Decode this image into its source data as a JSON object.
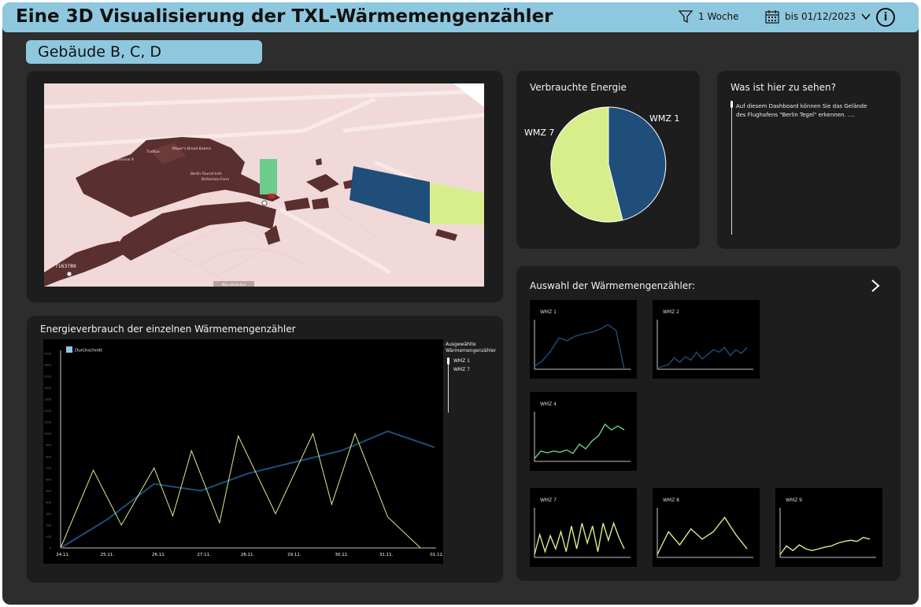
{
  "header": {
    "title": "Eine 3D Visualisierung der TXL-Wärmemengenzähler",
    "filter_label": "1 Woche",
    "date_label": "bis 01/12/2023",
    "filter_icon": "funnel-icon",
    "calendar_icon": "calendar-icon",
    "chevron_icon": "chevron-down-icon",
    "info_icon": "info-icon",
    "info_symbol": "i"
  },
  "building": {
    "label": "Gebäude B, C, D"
  },
  "map": {
    "labels": [
      "Mayer's Bread Bakers",
      "Trafikar",
      "Terminal A",
      "Berlin Tourist Info",
      "Britisches-Farm",
      "red bermo",
      "Layoutfier"
    ],
    "marker_text": "7163789",
    "bottom_tag": "Map attribution",
    "colors": {
      "ground": "#f1d9d9",
      "buildings": "#5a2f2f",
      "green_bar": "#6dcc8b",
      "blue_bar": "#1f4e7a",
      "yellow_bar": "#d8ee8c"
    }
  },
  "energy_pie": {
    "title": "Verbrauchte Energie",
    "label_wmz1": "WMZ 1",
    "label_wmz7": "WMZ 7"
  },
  "info_panel": {
    "title": "Was ist hier zu sehen?",
    "text": "Auf diesem Dashboard können Sie das Gelände des Flughafens \"Berlin Tegel\" erkennen. ...."
  },
  "consumption_chart": {
    "title": "Energieverbrauch der einzelnen Wärmemengenzähler",
    "legend_avg": "Durchschnitt",
    "selector_title": "Ausgewählte Wärmemengenzähler",
    "selector_items": [
      "WMZ 1",
      "WMZ 7"
    ]
  },
  "selection": {
    "title": "Auswahl der Wärmemengenzähler:",
    "next_icon": "chevron-right-icon",
    "tiles": [
      {
        "label": "WMZ 1"
      },
      {
        "label": "WMZ 2"
      },
      {
        "label": "WMZ 4"
      },
      {
        "label": "WMZ 7"
      },
      {
        "label": "WMZ 8"
      },
      {
        "label": "WMZ 9"
      }
    ]
  },
  "chart_data": [
    {
      "type": "pie",
      "title": "Verbrauchte Energie",
      "slices": [
        {
          "label": "WMZ 1",
          "value": 45,
          "color": "#1f4e7a"
        },
        {
          "label": "WMZ 7",
          "value": 55,
          "color": "#d8ee8c"
        }
      ]
    },
    {
      "type": "line",
      "title": "Energieverbrauch der einzelnen Wärmemengenzähler",
      "categories": [
        "24.11.",
        "25.11.",
        "26.11.",
        "27.11.",
        "28.11.",
        "29.11.",
        "30.11.",
        "31.11.",
        "01.12."
      ],
      "ytick_labels": [
        "0",
        "100",
        "200",
        "300",
        "400",
        "500",
        "600",
        "700",
        "800",
        "900",
        "1000",
        "1100",
        "1200",
        "1300",
        "1400",
        "1500",
        "1600",
        "1700"
      ],
      "ylim": [
        0,
        1700
      ],
      "series": [
        {
          "name": "WMZ 1",
          "color": "#1f4e7a",
          "x": [
            0,
            1,
            2,
            3,
            4,
            5,
            6,
            7,
            8
          ],
          "y": [
            0,
            250,
            560,
            500,
            650,
            750,
            850,
            1020,
            880
          ]
        },
        {
          "name": "WMZ 7",
          "color": "#d8ee8c",
          "x": [
            0,
            0.7,
            1.3,
            2,
            2.4,
            2.8,
            3.4,
            3.8,
            4.6,
            5.4,
            5.8,
            6.3,
            7.0,
            7.7
          ],
          "y": [
            0,
            680,
            200,
            700,
            280,
            850,
            220,
            980,
            300,
            1000,
            380,
            1000,
            270,
            0
          ]
        }
      ]
    },
    {
      "type": "line",
      "title": "WMZ 1",
      "x": [
        0,
        1,
        2,
        3,
        4,
        5,
        6,
        7,
        8,
        9,
        10,
        11
      ],
      "y": [
        5,
        15,
        32,
        55,
        50,
        58,
        62,
        65,
        70,
        78,
        68,
        0
      ],
      "color": "#1f4e7a"
    },
    {
      "type": "line",
      "title": "WMZ 2",
      "x": [
        0,
        1,
        2,
        3,
        4,
        5,
        6,
        7,
        8,
        9,
        10,
        11,
        12,
        13,
        14,
        15,
        16
      ],
      "y": [
        2,
        5,
        8,
        20,
        12,
        22,
        16,
        30,
        18,
        26,
        34,
        30,
        38,
        24,
        34,
        28,
        38
      ],
      "color": "#1f4e7a"
    },
    {
      "type": "line",
      "title": "WMZ 4",
      "x": [
        0,
        1,
        2,
        3,
        4,
        5,
        6,
        7,
        8,
        9,
        10,
        11,
        12,
        13,
        14
      ],
      "y": [
        5,
        18,
        15,
        18,
        16,
        20,
        14,
        30,
        22,
        36,
        45,
        65,
        55,
        62,
        55
      ],
      "color": "#6dcc8b"
    },
    {
      "type": "line",
      "title": "WMZ 7",
      "x": [
        0,
        1,
        2,
        3,
        4,
        5,
        6,
        7,
        8,
        9,
        10,
        11,
        12,
        13,
        14,
        15,
        16,
        17
      ],
      "y": [
        5,
        40,
        10,
        38,
        15,
        45,
        10,
        55,
        15,
        60,
        25,
        55,
        10,
        60,
        30,
        60,
        35,
        15
      ],
      "color": "#d8ee8c"
    },
    {
      "type": "line",
      "title": "WMZ 8",
      "x": [
        0,
        1,
        2,
        3,
        4,
        5,
        6,
        7,
        8
      ],
      "y": [
        5,
        45,
        22,
        50,
        32,
        45,
        70,
        40,
        15
      ],
      "color": "#d8ee8c"
    },
    {
      "type": "line",
      "title": "WMZ 9",
      "x": [
        0,
        1,
        2,
        3,
        4,
        5,
        6,
        7,
        8,
        9,
        10,
        11,
        12,
        13,
        14
      ],
      "y": [
        5,
        20,
        12,
        22,
        15,
        12,
        15,
        18,
        20,
        25,
        28,
        30,
        28,
        35,
        32
      ],
      "color": "#d8ee8c"
    }
  ]
}
